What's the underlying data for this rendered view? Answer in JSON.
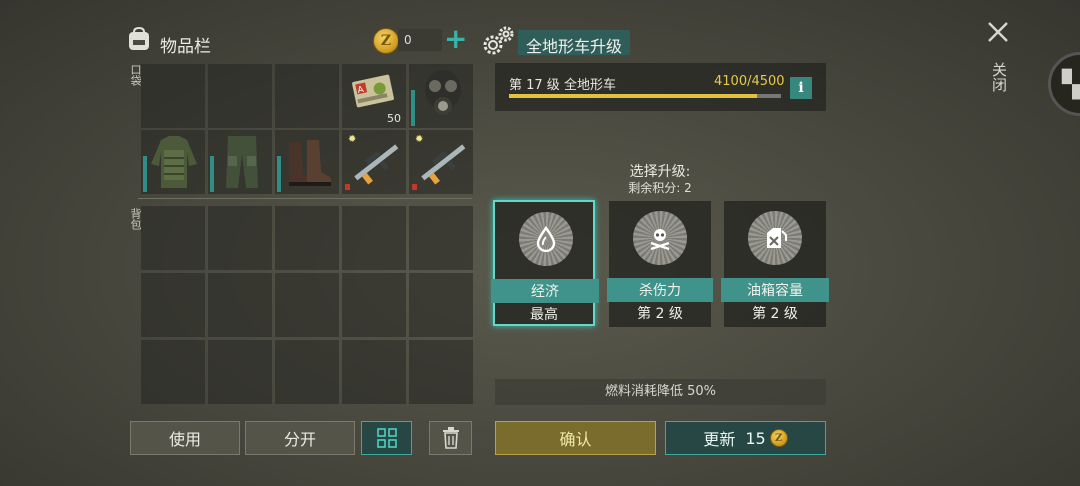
{
  "inventory": {
    "title": "物品栏",
    "pockets_label": "口袋",
    "backpack_label": "背包",
    "coins": "0",
    "plus_label": "+",
    "cell_count": "50"
  },
  "buttons": {
    "use": "使用",
    "split": "分开",
    "confirm": "确认",
    "refresh": "更新",
    "refresh_cost": "15"
  },
  "upgrade": {
    "title": "全地形车升级",
    "level_text": "第 17 级  全地形车",
    "xp_text": "4100/4500",
    "xp_fraction": 0.911,
    "info_label": "i",
    "choose_label": "选择升级:",
    "points_label": "剩余积分:  2",
    "options": [
      {
        "name": "经济",
        "level": "最高",
        "icon": "fuel-drop-icon",
        "selected": true
      },
      {
        "name": "杀伤力",
        "level": "第 2 级",
        "icon": "skull-crossbones-icon",
        "selected": false
      },
      {
        "name": "油箱容量",
        "level": "第 2 级",
        "icon": "fuel-can-icon",
        "selected": false
      }
    ],
    "effect_text": "燃料消耗降低 50%"
  },
  "close_label": "关闭",
  "colors": {
    "accent": "#3f938a",
    "gold": "#e2c23e",
    "select_border": "#5fd9cc"
  }
}
